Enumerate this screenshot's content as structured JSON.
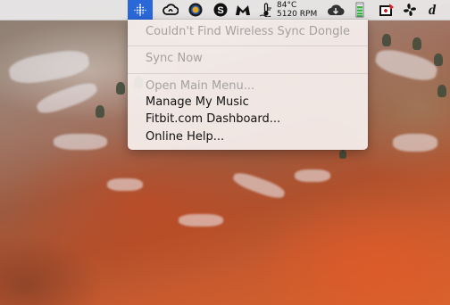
{
  "menubar": {
    "cpu_temp": "84°C",
    "fan_speed": "5120 RPM",
    "icons": [
      "fitbit-icon",
      "creative-cloud-icon",
      "circle-app-icon",
      "skype-icon",
      "malwarebytes-icon",
      "temperature-icon",
      "cloud-download-icon",
      "battery-icon",
      "rescue-icon",
      "fan-icon",
      "dictionary-icon"
    ]
  },
  "fitbit_menu": {
    "status": "Couldn't Find Wireless Sync Dongle",
    "sync_now": "Sync Now",
    "open_main_menu": "Open Main Menu...",
    "manage_music": "Manage My Music",
    "dashboard": "Fitbit.com Dashboard...",
    "online_help": "Online Help..."
  },
  "colors": {
    "fitbit_highlight": "#2a68d9",
    "disabled_text": "#a4a1a1",
    "battery_green": "#3bb34a"
  }
}
